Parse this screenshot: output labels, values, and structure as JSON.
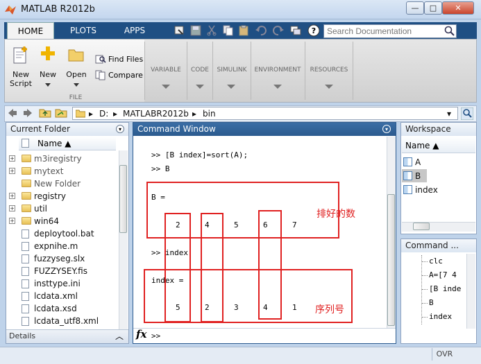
{
  "window": {
    "title": "MATLAB R2012b",
    "min": "—",
    "max": "□",
    "close": "✕"
  },
  "tabs": [
    "HOME",
    "PLOTS",
    "APPS"
  ],
  "search": {
    "placeholder": "Search Documentation"
  },
  "ribbon": {
    "new_script": "New\nScript",
    "new": "New",
    "open": "Open",
    "find_files": "Find Files",
    "compare": "Compare",
    "file_group": "FILE",
    "groups": [
      "VARIABLE",
      "CODE",
      "SIMULINK",
      "ENVIRONMENT",
      "RESOURCES"
    ]
  },
  "address": {
    "drive": "D:",
    "folder": "MATLABR2012b",
    "sub": "bin"
  },
  "current_folder": {
    "title": "Current Folder",
    "col_name": "Name ▲",
    "items": [
      {
        "name": "m3iregistry",
        "type": "folder",
        "expand": "+"
      },
      {
        "name": "mytext",
        "type": "folder",
        "expand": "+"
      },
      {
        "name": "New Folder",
        "type": "folder",
        "expand": ""
      },
      {
        "name": "registry",
        "type": "folder",
        "expand": "+"
      },
      {
        "name": "util",
        "type": "folder",
        "expand": "+"
      },
      {
        "name": "win64",
        "type": "folder",
        "expand": "+"
      },
      {
        "name": "deploytool.bat",
        "type": "file",
        "expand": ""
      },
      {
        "name": "expnihe.m",
        "type": "file",
        "expand": ""
      },
      {
        "name": "fuzzyseg.slx",
        "type": "file",
        "expand": ""
      },
      {
        "name": "FUZZYSEY.fis",
        "type": "file",
        "expand": ""
      },
      {
        "name": "insttype.ini",
        "type": "file",
        "expand": ""
      },
      {
        "name": "lcdata.xml",
        "type": "file",
        "expand": ""
      },
      {
        "name": "lcdata.xsd",
        "type": "file",
        "expand": ""
      },
      {
        "name": "lcdata_utf8.xml",
        "type": "file",
        "expand": ""
      }
    ],
    "details": "Details"
  },
  "command_window": {
    "title": "Command Window",
    "line1": ">> [B index]=sort(A);",
    "line2": ">> B",
    "b_label": "B =",
    "b_values": [
      "2",
      "4",
      "5",
      "6",
      "7"
    ],
    "line3": ">> index",
    "index_label": "index =",
    "index_values": [
      "5",
      "2",
      "3",
      "4",
      "1"
    ],
    "prompt": ">>",
    "fx": "fx",
    "note1": "排好的数",
    "note2": "序列号"
  },
  "workspace": {
    "title": "Workspace",
    "col_name": "Name ▲",
    "items": [
      "A",
      "B",
      "index"
    ]
  },
  "command_history": {
    "title": "Command ...",
    "items": [
      "clc",
      "A=[7 4",
      "[B inde",
      "B",
      "index"
    ]
  },
  "status": {
    "ovr": "OVR"
  }
}
